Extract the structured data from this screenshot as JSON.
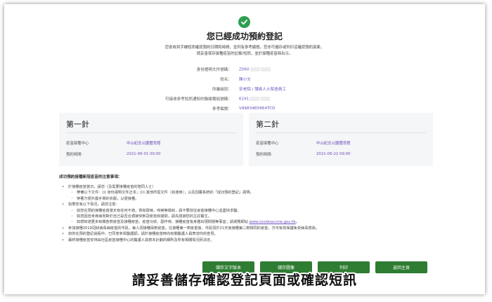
{
  "header": {
    "title": "您已經成功預約登記",
    "intro_line1": "您會收到手機短訊確認預約日期和時間，並列有參考編號。您亦可儲存或列印這確認預約頁面，",
    "intro_line2": "請妥善保存接種疫苗的記錄/短訊，並於接種疫苗時出示。"
  },
  "info": {
    "rows": [
      {
        "label": "身份證明文件號碼：",
        "value": "Z060"
      },
      {
        "label": "姓名：",
        "value": "陳小文"
      },
      {
        "label": "所屬組別：",
        "value": "安老院 / 殘疾人士院舍員工"
      },
      {
        "label": "可接收參考短訊通知的聯絡電話號碼：",
        "value": "6191"
      },
      {
        "label": "參考編號：",
        "value": "V99834ED6E4TCD"
      }
    ]
  },
  "dose1": {
    "title": "第一針",
    "centre_label": "疫苗接種中心",
    "centre_value": "中山紀念公園體育館",
    "date_label": "預約時間:",
    "date_value": "2021-06-01 09:00"
  },
  "dose2": {
    "title": "第二針",
    "centre_label": "疫苗接種中心",
    "centre_value": "中山紀念公園體育館",
    "date_label": "預約時間:",
    "date_value": "2021-06-22 09:00"
  },
  "notes": {
    "title": "成功預約接種新冠疫苗的注意事項：",
    "n1": "於接種疫苗當日，請您（及需要接種疫苗的陪同人士）",
    "n1a": "帶備以下文件：(i) 身份證明文件正本；(ii) 其他所需文件（如適用）；以及回覆系統的「成功預約登記」證明。",
    "n1b": "穿著方便外露手臂的衣服，以便接種。",
    "n2": "如果您有以下情況，請您注意：",
    "n2a": "如您在預約接種疫苗當天有任何不適，例如發燒，咳嗽等徵狀，請不要前往疫苗接種中心並盡快求醫。",
    "n2b": "如您因自身疾病而對於自己是否合適接受新冠疫苗有疑問，請先諮詢您的主診醫生。",
    "n2c": "如想知道更多有關各款疫苗及接種疫苗、疫苗功效、副作用、接種疫苗後身體出現問題等事宜；請瀏覽網站",
    "n2c_link": "www.covidvaccine.gov.hk",
    "n3": "參加接種2019冠狀病毒病疫苗的市民，每人須接種兩劑疫苗。在接種第一劑疫苗後，市民須於21天後接種第二劑相同的疫苗，方可有效保護免受病毒感染。",
    "n4": "如你在預約登記過程中，已同意參與醫護調，請於接種疫苗時向有關醫護人員表達你的意見。",
    "n5": "最終接種疫苗安排由社區疫苗接種中心的醫護人員按本計劃的細則及所有相關情況而決定。"
  },
  "buttons": {
    "save_text": "儲存文字版本",
    "save_image": "儲存圖像",
    "print": "列印",
    "home": "返回主頁"
  },
  "caption": "請妥善儲存確認登記頁面或確認短訊"
}
